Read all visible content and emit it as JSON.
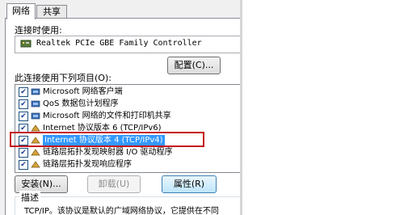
{
  "tabs": [
    {
      "label": "网络"
    },
    {
      "label": "共享"
    }
  ],
  "connect_using": {
    "label": "连接时使用:",
    "adapter": "Realtek PCIe GBE Family Controller",
    "configure_button": "配置(C)..."
  },
  "items_label": "此连接使用下列项目(O):",
  "items": [
    {
      "label": "Microsoft 网络客户端",
      "checked": true,
      "icon": "network-client-icon"
    },
    {
      "label": "QoS 数据包计划程序",
      "checked": true,
      "icon": "qos-icon"
    },
    {
      "label": "Microsoft 网络的文件和打印机共享",
      "checked": true,
      "icon": "file-share-icon"
    },
    {
      "label": "Internet 协议版本 6 (TCP/IPv6)",
      "checked": true,
      "icon": "protocol-icon"
    },
    {
      "label": "Internet 协议版本 4 (TCP/IPv4)",
      "checked": true,
      "icon": "protocol-icon",
      "selected": true
    },
    {
      "label": "链路层拓扑发现映射器 I/O 驱动程序",
      "checked": true,
      "icon": "protocol-icon"
    },
    {
      "label": "链路层拓扑发现响应程序",
      "checked": true,
      "icon": "protocol-icon"
    }
  ],
  "buttons": {
    "install": "安装(N)...",
    "uninstall": "卸载(U)",
    "properties": "属性(R)"
  },
  "description": {
    "title": "描述",
    "text": "TCP/IP。该协议是默认的广域网络协议，它提供在不同"
  },
  "colors": {
    "highlight": "#c4161c",
    "selection": "#3399ff"
  }
}
